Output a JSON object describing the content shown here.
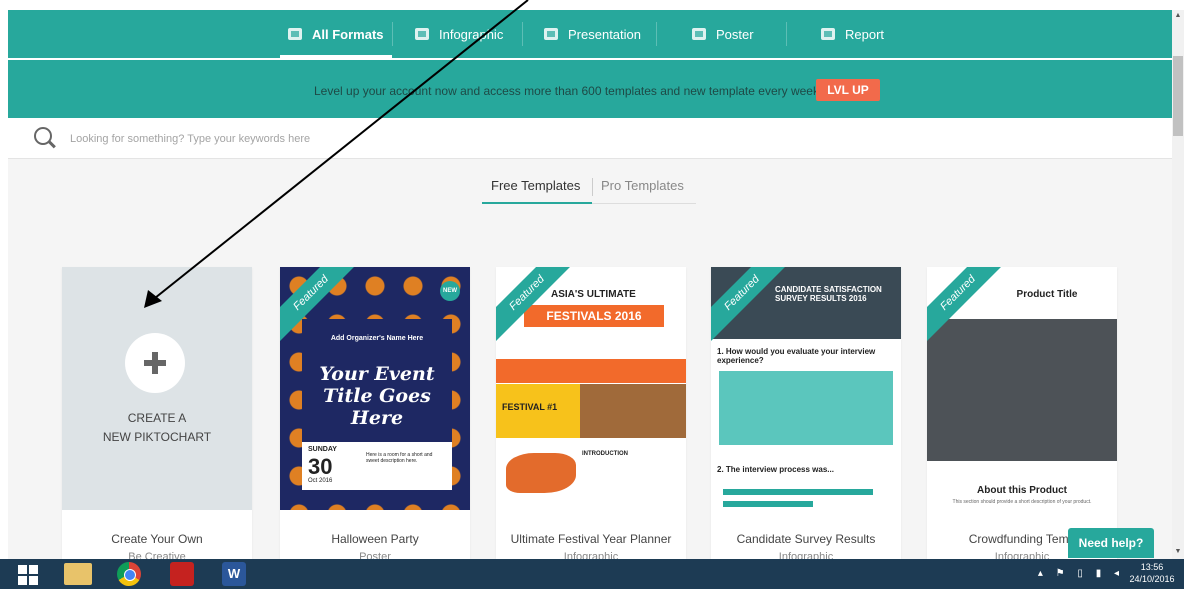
{
  "nav": {
    "tabs": [
      {
        "label": "All Formats",
        "icon": "document-icon",
        "active": true
      },
      {
        "label": "Infographic",
        "icon": "infographic-icon",
        "active": false
      },
      {
        "label": "Presentation",
        "icon": "presentation-icon",
        "active": false
      },
      {
        "label": "Poster",
        "icon": "poster-icon",
        "active": false
      },
      {
        "label": "Report",
        "icon": "report-icon",
        "active": false
      }
    ]
  },
  "banner": {
    "text": "Level up your account now and access more than 600 templates and new template every week",
    "button": "LVL UP"
  },
  "search": {
    "placeholder": "Looking for something? Type your keywords here"
  },
  "template_tabs": {
    "free": "Free Templates",
    "pro": "Pro Templates"
  },
  "cards": [
    {
      "title": "Create Your Own",
      "subtitle": "Be Creative",
      "create_label_1": "CREATE A",
      "create_label_2": "NEW PIKTOCHART"
    },
    {
      "title": "Halloween Party",
      "subtitle": "Poster",
      "ribbon": "Featured",
      "badge": "NEW",
      "thumb_org": "Add Organizer's Name Here",
      "thumb_title": "Your Event Title Goes Here",
      "thumb_day": "SUNDAY",
      "thumb_num": "30",
      "thumb_month": "Oct 2016",
      "thumb_desc": "Here is a room for a short and sweet description here."
    },
    {
      "title": "Ultimate Festival Year Planner",
      "subtitle": "Infographic",
      "ribbon": "Featured",
      "thumb_title": "ASIA'S ULTIMATE",
      "thumb_band": "FESTIVALS 2016",
      "thumb_label": "FESTIVAL #1",
      "thumb_intro": "INTRODUCTION"
    },
    {
      "title": "Candidate Survey Results",
      "subtitle": "Infographic",
      "ribbon": "Featured",
      "thumb_title": "CANDIDATE SATISFACTION SURVEY RESULTS 2016",
      "thumb_q1": "1. How would you evaluate your interview experience?",
      "thumb_q2": "2. The interview process was..."
    },
    {
      "title": "Crowdfunding Temp",
      "subtitle": "Infographic",
      "ribbon": "Featured",
      "thumb_title": "Product Title",
      "thumb_about": "About this Product",
      "thumb_desc": "This section should provide a short description of your product."
    }
  ],
  "help": {
    "label": "Need help?"
  },
  "taskbar": {
    "apps": [
      "windows-start-icon",
      "file-explorer-icon",
      "chrome-icon",
      "acrobat-icon",
      "word-icon"
    ],
    "word_letter": "W",
    "time": "13:56",
    "date": "24/10/2016"
  },
  "colors": {
    "brand": "#27a89c",
    "accent": "#f26a4b",
    "taskbar": "#1d3b54"
  }
}
